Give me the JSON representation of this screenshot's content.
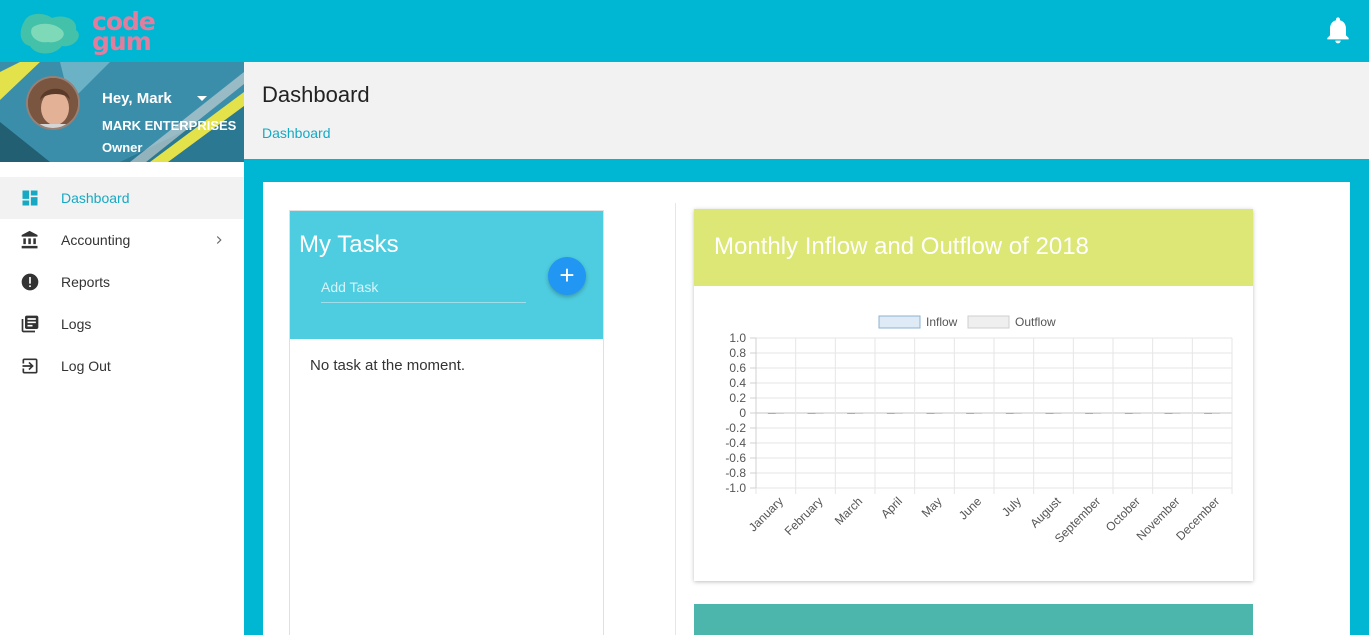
{
  "app": {
    "logo_text_line1": "code",
    "logo_text_line2": "gum",
    "bell_icon": "bell-icon"
  },
  "profile": {
    "greeting": "Hey, Mark",
    "company": "MARK ENTERPRISES",
    "role": "Owner"
  },
  "sidebar": {
    "items": [
      {
        "label": "Dashboard",
        "icon": "dashboard-icon",
        "active": true
      },
      {
        "label": "Accounting",
        "icon": "bank-icon",
        "has_submenu": true
      },
      {
        "label": "Reports",
        "icon": "alert-circle-icon"
      },
      {
        "label": "Logs",
        "icon": "library-books-icon"
      },
      {
        "label": "Log Out",
        "icon": "logout-icon"
      }
    ]
  },
  "header": {
    "title": "Dashboard",
    "breadcrumb": "Dashboard"
  },
  "tasks": {
    "title": "My Tasks",
    "input_placeholder": "Add Task",
    "add_label": "+",
    "empty_text": "No task at the moment."
  },
  "colors": {
    "primary": "#00b7d3",
    "tasks_header": "#4ecde0",
    "chart_header": "#dce775",
    "add_button": "#2196f3",
    "second_card": "#4db6ac"
  },
  "chart_data": {
    "type": "bar",
    "title": "Monthly Inflow and Outflow of 2018",
    "categories": [
      "January",
      "February",
      "March",
      "April",
      "May",
      "June",
      "July",
      "August",
      "September",
      "October",
      "November",
      "December"
    ],
    "series": [
      {
        "name": "Inflow",
        "values": [
          0,
          0,
          0,
          0,
          0,
          0,
          0,
          0,
          0,
          0,
          0,
          0
        ]
      },
      {
        "name": "Outflow",
        "values": [
          0,
          0,
          0,
          0,
          0,
          0,
          0,
          0,
          0,
          0,
          0,
          0
        ]
      }
    ],
    "ylim": [
      -1.0,
      1.0
    ],
    "yticks": [
      "1.0",
      "0.8",
      "0.6",
      "0.4",
      "0.2",
      "0",
      "-0.2",
      "-0.4",
      "-0.6",
      "-0.8",
      "-1.0"
    ],
    "grid": true,
    "legend": "top-center"
  }
}
